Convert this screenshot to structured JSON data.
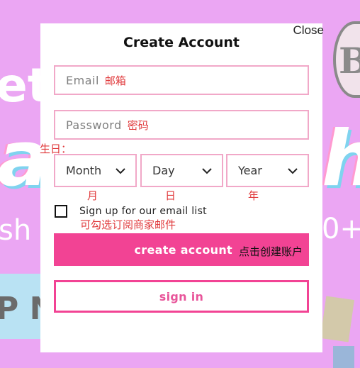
{
  "background": {
    "fragment_et": "et",
    "fragment_ah_left": "a",
    "fragment_ah_right": "h",
    "fragment_sh": "sh s",
    "fragment_plus": "0+",
    "fragment_pno": "P NO",
    "badge_letter": "B"
  },
  "modal": {
    "close_label": "Close",
    "title": "Create Account",
    "email": {
      "placeholder": "Email",
      "annotation": "邮箱"
    },
    "password": {
      "placeholder": "Password",
      "annotation": "密码"
    },
    "birthday_annotation": "生日：",
    "month": {
      "value": "Month",
      "annotation": "月"
    },
    "day": {
      "value": "Day",
      "annotation": "日"
    },
    "year": {
      "value": "Year",
      "annotation": "年"
    },
    "subscribe": {
      "label": "Sign up for our email list",
      "annotation": "可勾选订阅商家邮件",
      "checked": false
    },
    "create_button": {
      "label": "create account",
      "annotation": "点击创建账户"
    },
    "signin_button": {
      "label": "sign in"
    }
  },
  "colors": {
    "page_background": "#eba6f3",
    "accent_pink": "#f24394",
    "field_border": "#f1a8c8",
    "annotation_red": "#e0393b"
  }
}
